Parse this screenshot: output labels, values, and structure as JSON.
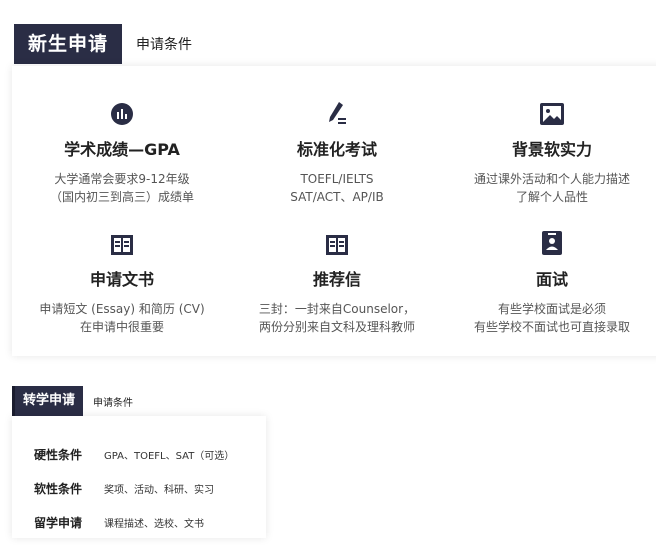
{
  "section_new": {
    "title": "新生申请",
    "subtitle": "申请条件",
    "items": [
      {
        "icon": "chart-icon",
        "heading": "学术成绩—GPA",
        "line1": "大学通常会要求9-12年级",
        "line2": "（国内初三到高三）成绩单"
      },
      {
        "icon": "pen-icon",
        "heading": "标准化考试",
        "line1": "TOEFL/IELTS",
        "line2": "SAT/ACT、AP/IB"
      },
      {
        "icon": "image-icon",
        "heading": "背景软实力",
        "line1": "通过课外活动和个人能力描述",
        "line2": "了解个人品性"
      },
      {
        "icon": "book-icon",
        "heading": "申请文书",
        "line1": "申请短文 (Essay) 和简历 (CV)",
        "line2": "在申请中很重要"
      },
      {
        "icon": "book-icon",
        "heading": "推荐信",
        "line1": "三封：一封来自Counselor，",
        "line2": "两份分别来自文科及理科教师"
      },
      {
        "icon": "id-badge-icon",
        "heading": "面试",
        "line1": "有些学校面试是必须",
        "line2": "有些学校不面试也可直接录取"
      }
    ]
  },
  "section_transfer": {
    "title": "转学申请",
    "subtitle": "申请条件",
    "rows": [
      {
        "key": "硬性条件",
        "value": "GPA、TOEFL、SAT（可选）"
      },
      {
        "key": "软性条件",
        "value": "奖项、活动、科研、实习"
      },
      {
        "key": "留学申请",
        "value": "课程描述、选校、文书"
      }
    ]
  },
  "colors": {
    "header_bg": "#2a2d45",
    "icon": "#2a2d45"
  }
}
